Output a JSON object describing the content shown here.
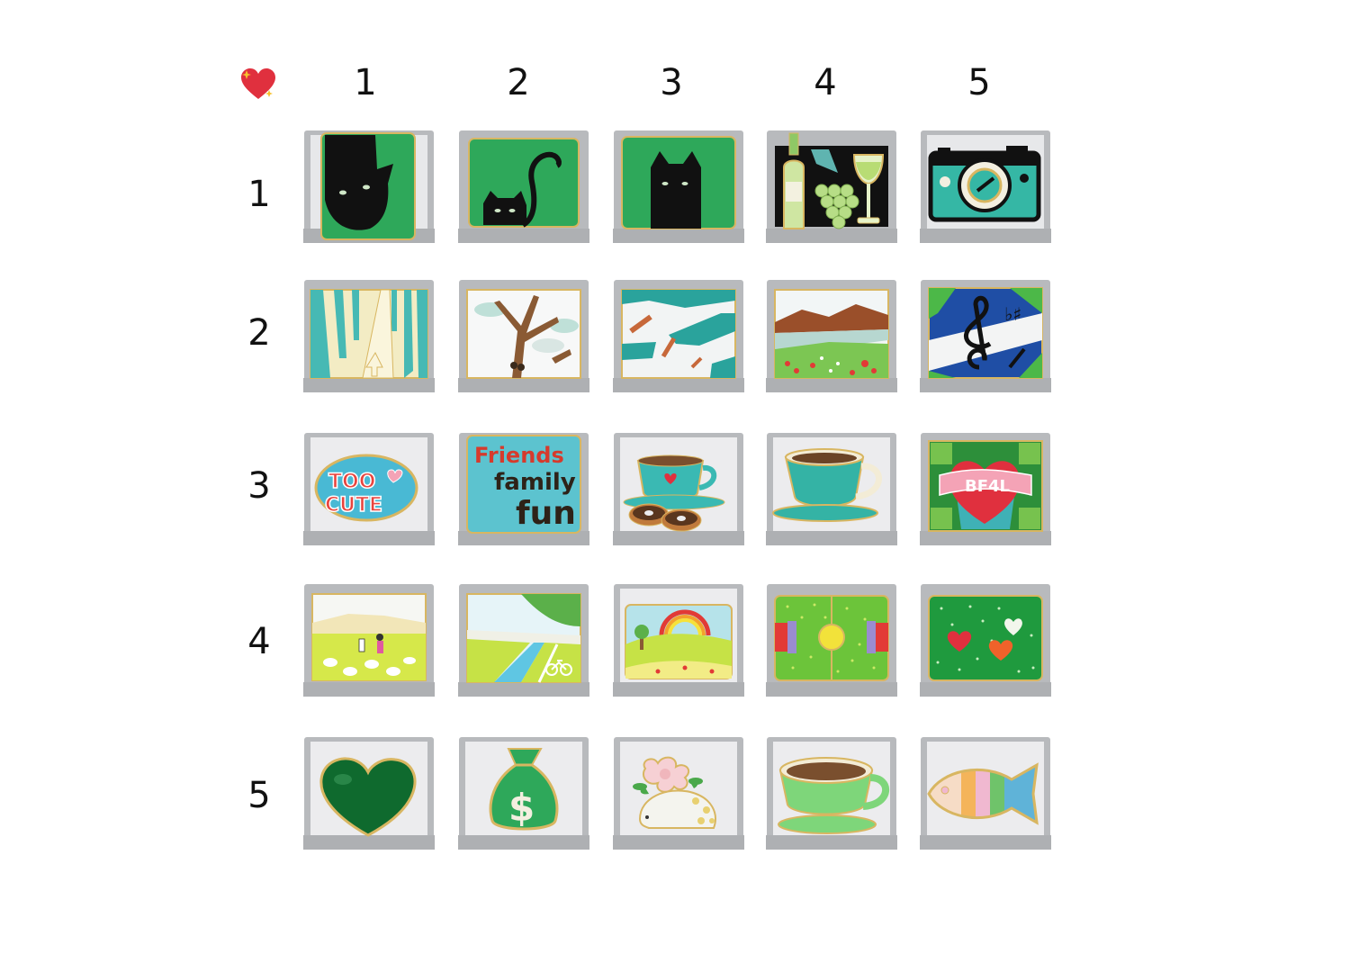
{
  "header": {
    "corner_icon": "sparkling-heart-icon",
    "columns": [
      "1",
      "2",
      "3",
      "4",
      "5"
    ]
  },
  "rows": [
    "1",
    "2",
    "3",
    "4",
    "5"
  ],
  "charm_texts": {
    "too_cute_line1": "TOO",
    "too_cute_line2": "CUTE",
    "friends": "Friends",
    "family": "family",
    "fun": "fun",
    "bf4l": "BF4L"
  },
  "colors": {
    "enamel_green": "#2ea85a",
    "teal": "#35b7a5",
    "heart_red": "#e0303e",
    "steel": "#c9cbce"
  }
}
